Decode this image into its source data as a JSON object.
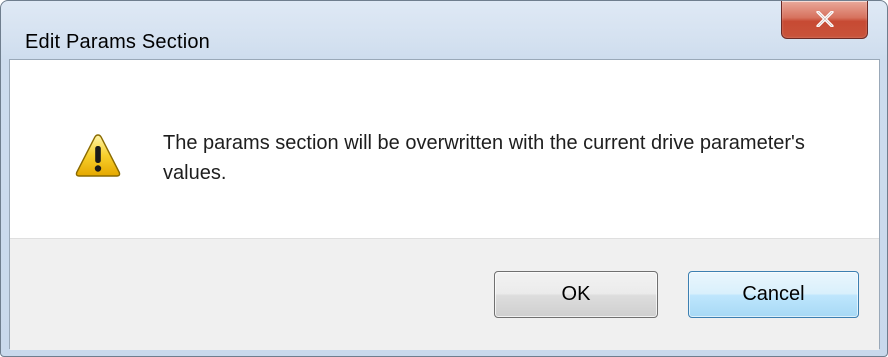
{
  "window": {
    "title": "Edit Params Section",
    "close_icon": "close-icon"
  },
  "dialog": {
    "icon": "warning-icon",
    "message": "The params section will be overwritten with the current drive parameter's values."
  },
  "buttons": {
    "ok_label": "OK",
    "cancel_label": "Cancel"
  },
  "colors": {
    "close_button": "#c74a33",
    "warning_fill": "#f5c518",
    "footer_bg": "#f0f0f0",
    "focused_button_border": "#3c7fb1"
  }
}
